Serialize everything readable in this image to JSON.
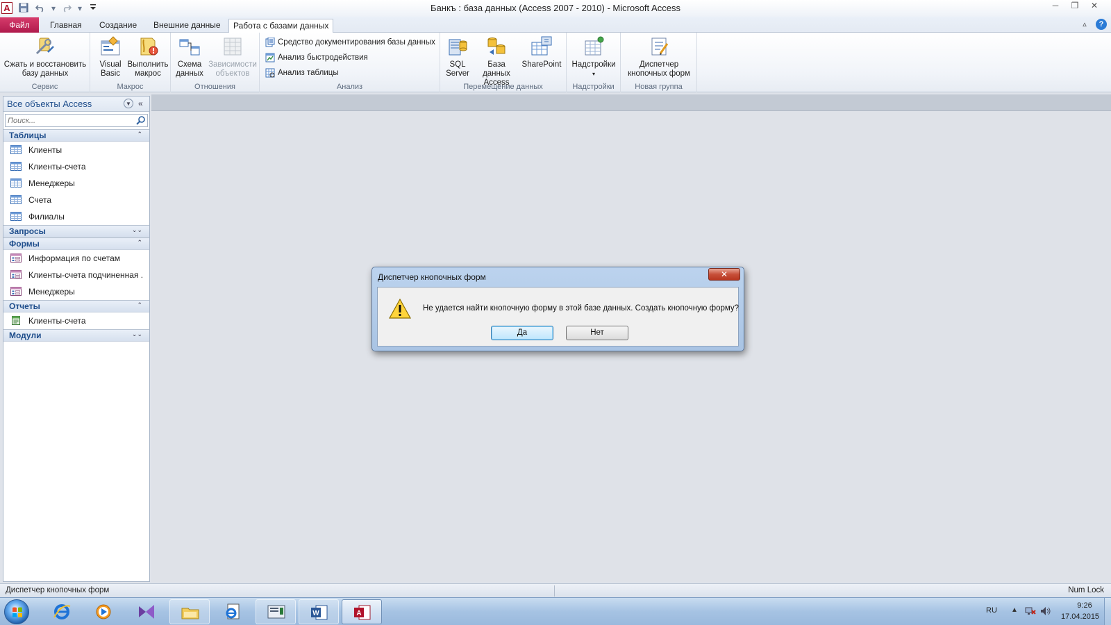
{
  "window": {
    "title": "Банкъ : база данных (Access 2007 - 2010)  -  Microsoft Access",
    "app_logo": "A",
    "qat": [
      "save-icon",
      "undo-icon",
      "redo-icon",
      "customize-qat-icon"
    ],
    "controls": {
      "minimize": "─",
      "restore": "❐",
      "close": "✕"
    }
  },
  "tabs": {
    "file": "Файл",
    "items": [
      "Главная",
      "Создание",
      "Внешние данные",
      "Работа с базами данных"
    ],
    "active_index": 3
  },
  "ribbon": {
    "groups": [
      {
        "label": "Сервис",
        "buttons": [
          {
            "label_line1": "Сжать и восстановить",
            "label_line2": "базу данных"
          }
        ]
      },
      {
        "label": "Макрос",
        "buttons": [
          {
            "label_line1": "Visual",
            "label_line2": "Basic"
          },
          {
            "label_line1": "Выполнить",
            "label_line2": "макрос"
          }
        ]
      },
      {
        "label": "Отношения",
        "buttons": [
          {
            "label_line1": "Схема",
            "label_line2": "данных"
          },
          {
            "label_line1": "Зависимости",
            "label_line2": "объектов",
            "disabled": true
          }
        ]
      },
      {
        "label": "Анализ",
        "small_buttons": [
          "Средство документирования базы данных",
          "Анализ быстродействия",
          "Анализ таблицы"
        ]
      },
      {
        "label": "Перемещение данных",
        "buttons": [
          {
            "label_line1": "SQL",
            "label_line2": "Server"
          },
          {
            "label_line1": "База данных",
            "label_line2": "Access"
          },
          {
            "label_line1": "SharePoint",
            "label_line2": ""
          }
        ]
      },
      {
        "label": "Надстройки",
        "buttons": [
          {
            "label_line1": "Надстройки",
            "label_line2": "▾"
          }
        ]
      },
      {
        "label": "Новая группа",
        "buttons": [
          {
            "label_line1": "Диспетчер",
            "label_line2": "кнопочных форм"
          }
        ]
      }
    ]
  },
  "nav": {
    "title": "Все объекты Access",
    "search_placeholder": "Поиск...",
    "sections": [
      {
        "label": "Таблицы",
        "expanded": true,
        "items": [
          "Клиенты",
          "Клиенты-счета",
          "Менеджеры",
          "Счета",
          "Филиалы"
        ]
      },
      {
        "label": "Запросы",
        "expanded": false,
        "items": []
      },
      {
        "label": "Формы",
        "expanded": true,
        "items": [
          "Информация по счетам",
          "Клиенты-счета подчиненная ...",
          "Менеджеры"
        ]
      },
      {
        "label": "Отчеты",
        "expanded": true,
        "items": [
          "Клиенты-счета"
        ]
      },
      {
        "label": "Модули",
        "expanded": false,
        "items": []
      }
    ]
  },
  "dialog": {
    "title": "Диспетчер кнопочных форм",
    "close": "✕",
    "message": "Не удается найти кнопочную форму в этой базе данных.  Создать кнопочную форму?",
    "yes": "Да",
    "no": "Нет"
  },
  "status": {
    "left": "Диспетчер кнопочных форм",
    "right": "Num Lock"
  },
  "taskbar": {
    "lang": "RU",
    "time": "9:26",
    "date": "17.04.2015",
    "colors": {
      "accent": "#b01a4c",
      "nav_title": "#1f4e8c"
    }
  }
}
